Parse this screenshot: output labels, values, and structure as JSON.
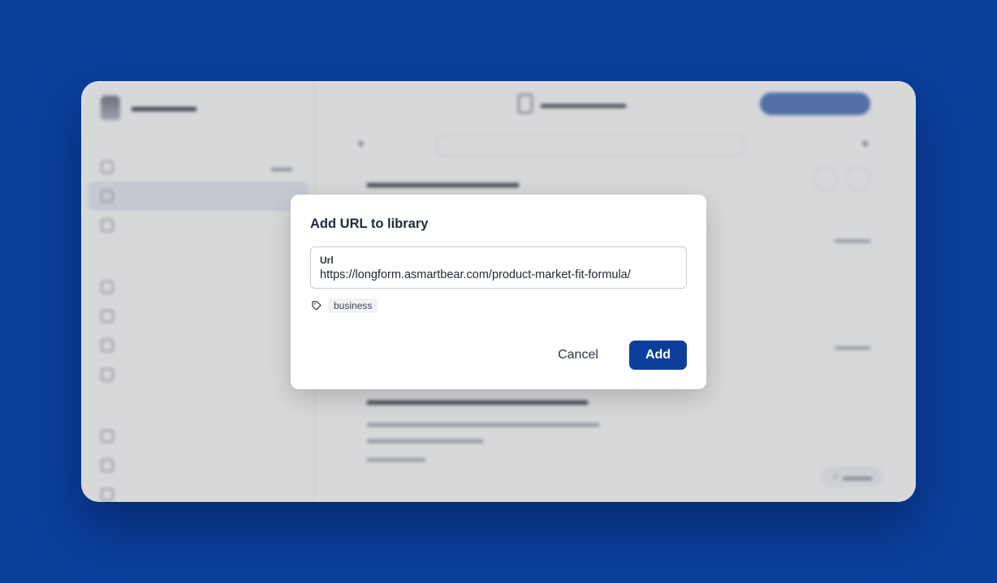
{
  "colors": {
    "background": "#0a3f9c",
    "primary_button": "#0b3f9a",
    "modal_bg": "#ffffff"
  },
  "modal": {
    "title": "Add URL to library",
    "url_label": "Url",
    "url_value": "https://longform.asmartbear.com/product-market-fit-formula/",
    "tags": [
      "business"
    ],
    "cancel_label": "Cancel",
    "add_label": "Add"
  }
}
